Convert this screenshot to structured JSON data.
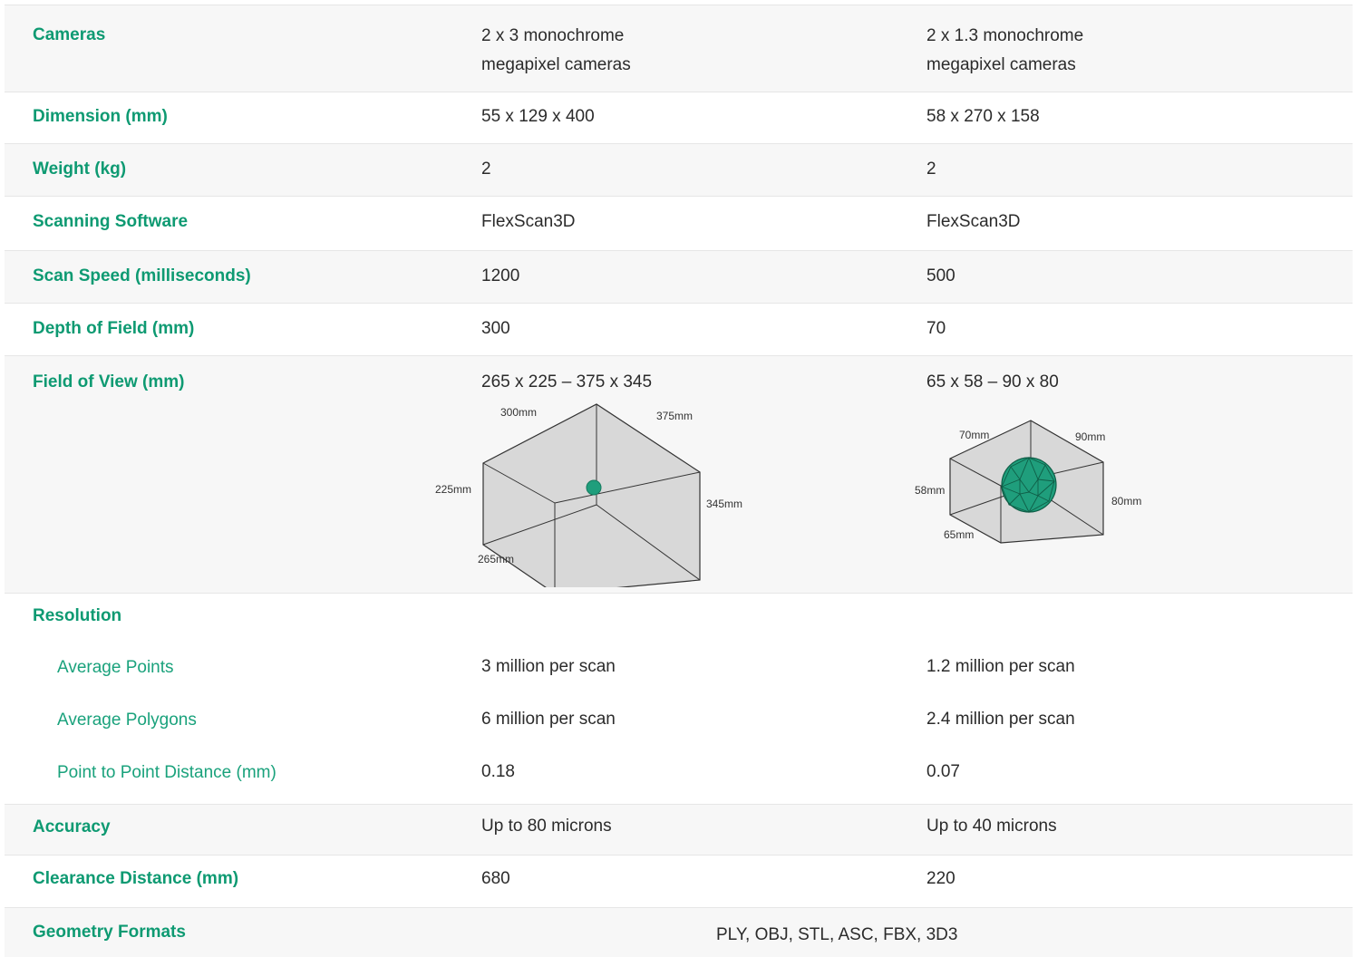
{
  "rows": {
    "cameras": {
      "label": "Cameras",
      "v1_line1": "2 x 3 monochrome",
      "v1_line2": "megapixel cameras",
      "v2_line1": "2 x 1.3 monochrome",
      "v2_line2": "megapixel cameras"
    },
    "dimension": {
      "label": "Dimension (mm)",
      "v1": "55 x 129 x 400",
      "v2": "58 x 270 x 158"
    },
    "weight": {
      "label": "Weight (kg)",
      "v1": "2",
      "v2": "2"
    },
    "software": {
      "label": "Scanning Software",
      "v1": "FlexScan3D",
      "v2": "FlexScan3D"
    },
    "scan_speed": {
      "label": "Scan Speed (milliseconds)",
      "v1": "1200",
      "v2": "500"
    },
    "depth": {
      "label": "Depth of Field (mm)",
      "v1": "300",
      "v2": "70"
    },
    "fov": {
      "label": "Field of View (mm)",
      "v1": "265 x 225 – 375 x 345",
      "v2": "65 x 58 – 90 x 80",
      "diagram1": {
        "top_left": "300mm",
        "top_right": "375mm",
        "left": "225mm",
        "right": "345mm",
        "bottom": "265mm"
      },
      "diagram2": {
        "top_left": "70mm",
        "top_right": "90mm",
        "left": "58mm",
        "right": "80mm",
        "bottom": "65mm"
      }
    },
    "resolution": {
      "label": "Resolution"
    },
    "avg_points": {
      "label": "Average Points",
      "v1": "3 million per scan",
      "v2": "1.2 million per scan"
    },
    "avg_polygons": {
      "label": "Average Polygons",
      "v1": "6 million per scan",
      "v2": "2.4 million per scan"
    },
    "p2p": {
      "label": "Point to Point Distance (mm)",
      "v1": "0.18",
      "v2": "0.07"
    },
    "accuracy": {
      "label": "Accuracy",
      "v1": "Up to 80 microns",
      "v2": "Up to 40 microns"
    },
    "clearance": {
      "label": "Clearance Distance (mm)",
      "v1": "680",
      "v2": "220"
    },
    "geometry": {
      "label": "Geometry Formats",
      "value": "PLY, OBJ, STL, ASC, FBX, 3D3"
    }
  },
  "colors": {
    "accent": "#0e9a72",
    "sphere": "#1f9e7c",
    "box_fill": "#d8d8d8",
    "row_alt": "#f7f7f7"
  }
}
